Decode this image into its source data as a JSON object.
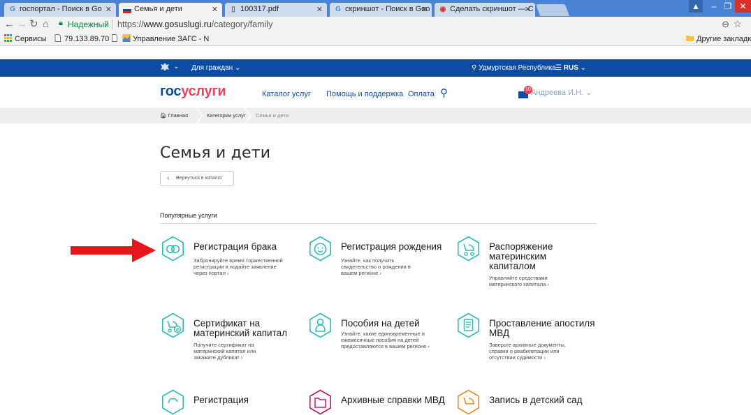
{
  "browser": {
    "tabs": [
      {
        "title": "госпортал - Поиск в Go",
        "favicon": "G",
        "favcolor": "#4285f4",
        "active": false
      },
      {
        "title": "Семья и дети",
        "favicon": "flag",
        "favcolor": "#0d4ca3",
        "active": true
      },
      {
        "title": "100317.pdf",
        "favicon": "doc",
        "favcolor": "#666",
        "active": false
      },
      {
        "title": "скриншот - Поиск в Goo",
        "favicon": "G",
        "favcolor": "#4285f4",
        "active": false
      },
      {
        "title": "Сделать скриншот — С",
        "favicon": "S",
        "favcolor": "#d93025",
        "active": false
      }
    ],
    "address": {
      "secure_label": "Надежный",
      "url_scheme": "https://",
      "url_host": "www.gosuslugi.ru",
      "url_path": "/category/family"
    },
    "bookmarks": [
      {
        "label": "Сервисы",
        "icon": "apps-icon"
      },
      {
        "label": "79.133.89.70",
        "icon": "page-icon"
      },
      {
        "label": "Управление ЗАГС - N",
        "icon": "emblem-icon"
      }
    ],
    "other_bookmarks": "Другие закладки"
  },
  "site": {
    "topbar": {
      "audience": "Для граждан",
      "region": "Удмуртская Республика",
      "lang": "RUS"
    },
    "logo": {
      "part1": "гос",
      "part2": "услуги"
    },
    "nav": [
      "Каталог услуг",
      "Помощь и поддержка",
      "Оплата"
    ],
    "user": "Андреева И.Н.",
    "mail_count": "10",
    "breadcrumbs": [
      "Главная",
      "Категории услуг",
      "Семья и дети"
    ],
    "page_title": "Семья и дети",
    "back_label": "Вернуться в каталог",
    "section_title": "Популярные услуги",
    "services": [
      {
        "title": "Регистрация брака",
        "desc": "Забронируйте время торжественной регистрации и подайте заявление через портал",
        "icon": "rings-icon",
        "color": "#2dbdb6"
      },
      {
        "title": "Регистрация рождения",
        "desc": "Узнайте, как получить свидетельство о рождении в вашем регионе",
        "icon": "baby-icon",
        "color": "#2dbdb6"
      },
      {
        "title": "Распоряжение материнским капиталом",
        "desc": "Управляйте средствами материнского капитала",
        "icon": "stroller-icon",
        "color": "#2dbdb6"
      },
      {
        "title": "Сертификат на материнский капитал",
        "desc": "Получите сертификат на материнский капитал или закажите дубликат",
        "icon": "stroller-coin-icon",
        "color": "#2dbdb6"
      },
      {
        "title": "Пособия на детей",
        "desc": "Узнайте, какие единовременные и ежемесячные пособия на детей предоставляются в вашем регионе",
        "icon": "child-icon",
        "color": "#2dbdb6"
      },
      {
        "title": "Проставление апостиля МВД",
        "desc": "Заверьте архивные документы, справки о реабилитации или отсутствии судимости",
        "icon": "document-icon",
        "color": "#2dbdb6"
      },
      {
        "title": "Регистрация",
        "desc": "",
        "icon": "hand-icon",
        "color": "#2dbdb6"
      },
      {
        "title": "Архивные справки МВД",
        "desc": "",
        "icon": "folder-icon",
        "color": "#c2185b"
      },
      {
        "title": "Запись в детский сад",
        "desc": "",
        "icon": "stroller-orange-icon",
        "color": "#f08a24"
      }
    ],
    "arrow_color": "#e8161b"
  }
}
